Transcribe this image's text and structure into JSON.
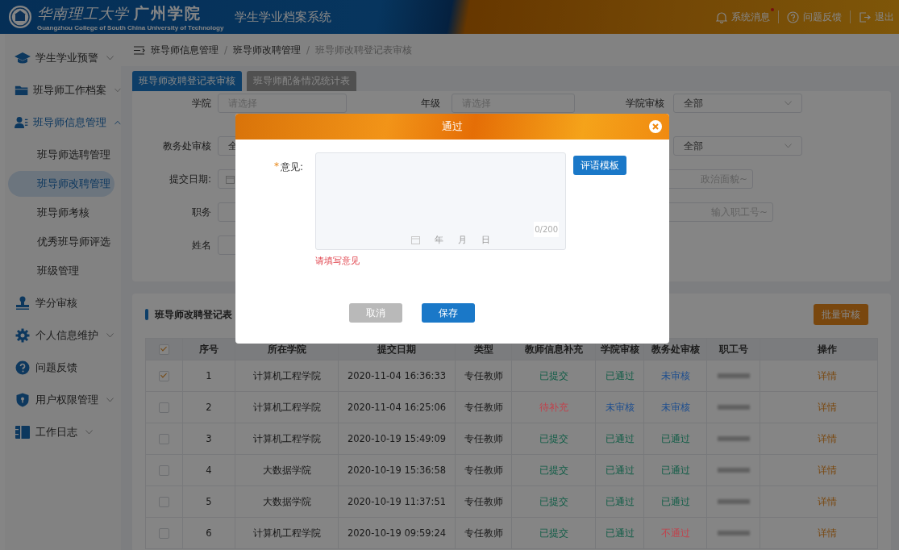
{
  "header": {
    "school_script": "华南理工大学",
    "school_name": "广州学院",
    "school_english": "Guangzhou College of South China University of Technology",
    "system_title": "学生学业档案系统",
    "actions": [
      {
        "kind": "bell",
        "label": "系统消息",
        "unread": true
      },
      {
        "kind": "help",
        "label": "问题反馈",
        "unread": false
      },
      {
        "kind": "exit",
        "label": "退出",
        "unread": false
      }
    ]
  },
  "sidebar": {
    "items": [
      {
        "label": "学生学业预警",
        "has_submenu": true,
        "expanded": false
      },
      {
        "label": "班导师工作档案",
        "has_submenu": true,
        "expanded": false
      },
      {
        "label": "班导师信息管理",
        "has_submenu": true,
        "expanded": true,
        "children": [
          {
            "label": "班导师选聘管理",
            "selected": false
          },
          {
            "label": "班导师改聘管理",
            "selected": true
          },
          {
            "label": "班导师考核",
            "selected": false
          },
          {
            "label": "优秀班导师评选",
            "selected": false
          },
          {
            "label": "班级管理",
            "selected": false
          }
        ]
      },
      {
        "label": "学分审核",
        "has_submenu": false,
        "expanded": false
      },
      {
        "label": "个人信息维护",
        "has_submenu": true,
        "expanded": false
      },
      {
        "label": "问题反馈",
        "has_submenu": false,
        "expanded": false
      },
      {
        "label": "用户权限管理",
        "has_submenu": true,
        "expanded": false
      },
      {
        "label": "工作日志",
        "has_submenu": true,
        "expanded": false
      }
    ]
  },
  "breadcrumb": {
    "separator": "/",
    "items": [
      "班导师信息管理",
      "班导师改聘管理",
      "班导师改聘登记表审核"
    ]
  },
  "tabs": [
    {
      "label": "班导师改聘登记表审核",
      "selected": true
    },
    {
      "label": "班导师配备情况统计表",
      "selected": false
    }
  ],
  "filters": [
    [
      {
        "label": "学院",
        "kind": "select",
        "placeholder": "请选择"
      },
      {
        "label": "年级",
        "kind": "select",
        "placeholder": "请选择"
      },
      {
        "label": "学院审核",
        "kind": "select",
        "value": "全部"
      }
    ],
    [
      {
        "label": "教务处审核",
        "kind": "select",
        "value": "全"
      },
      {
        "kind": "select",
        "value": "全部"
      }
    ],
    [
      {
        "label": "提交日期:",
        "kind": "date"
      },
      {
        "kind": "input",
        "placeholder": "政治面貌~"
      }
    ],
    [
      {
        "label": "职务",
        "kind": "input"
      },
      {
        "kind": "input",
        "placeholder": "输入职工号~"
      }
    ],
    [
      {
        "label": "姓名",
        "kind": "input"
      }
    ]
  ],
  "table": {
    "title": "班导师改聘登记表",
    "batch_button": "批量审核",
    "select_all_checked": true,
    "columns": [
      "序号",
      "所在学院",
      "提交日期",
      "类型",
      "教师信息补充",
      "学院审核",
      "教务处审核",
      "职工号",
      "操作"
    ],
    "rows": [
      {
        "checked": true,
        "index": "1",
        "college": "计算机工程学院",
        "date": "2020-11-04 16:36:33",
        "type": "专任教师",
        "info": {
          "text": "已提交",
          "color": "#0e5c45"
        },
        "college_review": {
          "text": "已通过",
          "color": "#0e5c45"
        },
        "office_review": {
          "text": "未审核",
          "color": "#1f4f8f"
        },
        "action": "详情"
      },
      {
        "checked": false,
        "index": "2",
        "college": "计算机工程学院",
        "date": "2020-11-04 16:25:06",
        "type": "专任教师",
        "info": {
          "text": "待补充",
          "color": "#c2414b"
        },
        "college_review": {
          "text": "未审核",
          "color": "#1f4f8f"
        },
        "office_review": {
          "text": "未审核",
          "color": "#1f4f8f"
        },
        "action": "详情"
      },
      {
        "checked": false,
        "index": "3",
        "college": "计算机工程学院",
        "date": "2020-10-19 15:49:09",
        "type": "专任教师",
        "info": {
          "text": "已提交",
          "color": "#0e5c45"
        },
        "college_review": {
          "text": "已通过",
          "color": "#0e5c45"
        },
        "office_review": {
          "text": "已通过",
          "color": "#0e5c45"
        },
        "action": "详情"
      },
      {
        "checked": false,
        "index": "4",
        "college": "大数据学院",
        "date": "2020-10-19 15:36:58",
        "type": "专任教师",
        "info": {
          "text": "已提交",
          "color": "#0e5c45"
        },
        "college_review": {
          "text": "已通过",
          "color": "#0e5c45"
        },
        "office_review": {
          "text": "已通过",
          "color": "#0e5c45"
        },
        "action": "详情"
      },
      {
        "checked": false,
        "index": "5",
        "college": "大数据学院",
        "date": "2020-10-19 11:37:51",
        "type": "专任教师",
        "info": {
          "text": "已提交",
          "color": "#0e5c45"
        },
        "college_review": {
          "text": "已通过",
          "color": "#0e5c45"
        },
        "office_review": {
          "text": "已通过",
          "color": "#0e5c45"
        },
        "action": "详情"
      },
      {
        "checked": false,
        "index": "6",
        "college": "计算机工程学院",
        "date": "2020-10-19 09:59:24",
        "type": "专任教师",
        "info": {
          "text": "已提交",
          "color": "#0e5c45"
        },
        "college_review": {
          "text": "已通过",
          "color": "#0e5c45"
        },
        "office_review": {
          "text": "不通过",
          "color": "#c2414b"
        },
        "action": "详情"
      }
    ]
  },
  "dialog": {
    "title": "通过",
    "field_label": "意见:",
    "required_mark": "*",
    "template_button": "评语模板",
    "date_ghost": [
      "年",
      "月",
      "日"
    ],
    "counter": "0/200",
    "error": "请填写意见",
    "buttons": [
      {
        "kind": "cancel",
        "label": "取消"
      },
      {
        "kind": "primary",
        "label": "保存"
      }
    ]
  }
}
